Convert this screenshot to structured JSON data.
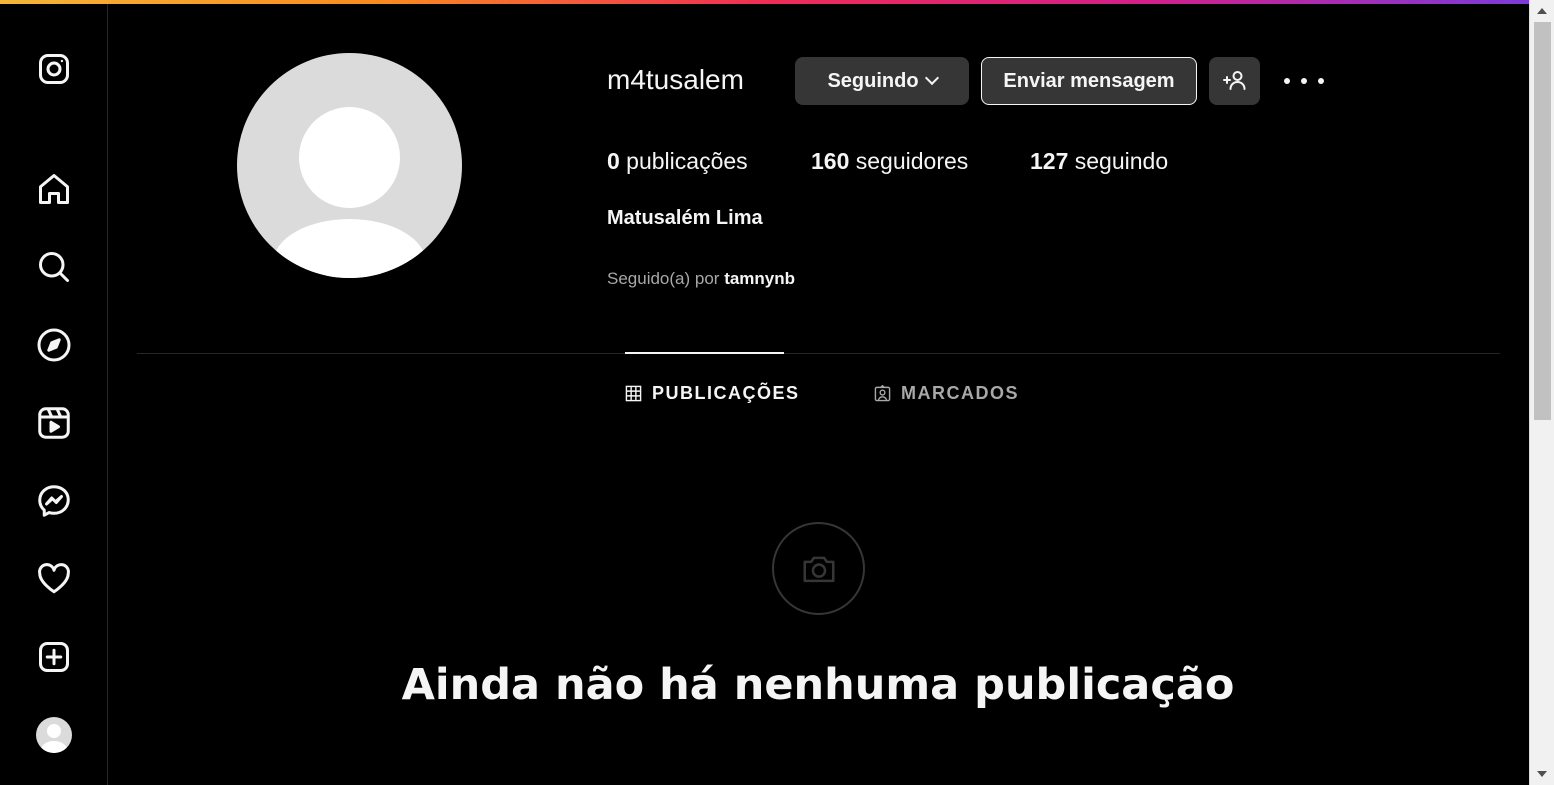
{
  "sidebar": {
    "items": [
      {
        "icon": "instagram-logo-icon"
      },
      {
        "icon": "home-icon"
      },
      {
        "icon": "search-icon"
      },
      {
        "icon": "explore-icon"
      },
      {
        "icon": "reels-icon"
      },
      {
        "icon": "messenger-icon"
      },
      {
        "icon": "heart-icon"
      },
      {
        "icon": "create-icon"
      },
      {
        "icon": "profile-avatar-icon"
      }
    ]
  },
  "profile": {
    "username": "m4tusalem",
    "following_button": "Seguindo",
    "message_button": "Enviar mensagem",
    "stats": {
      "posts_count": "0",
      "posts_label": " publicações",
      "followers_count": "160",
      "followers_label": " seguidores",
      "following_count": "127",
      "following_label": " seguindo"
    },
    "full_name": "Matusalém Lima",
    "followed_by_prefix": "Seguido(a) por ",
    "followed_by_user": "tamnynb"
  },
  "tabs": [
    {
      "label": "PUBLICAÇÕES",
      "active": true
    },
    {
      "label": "MARCADOS",
      "active": false
    }
  ],
  "empty_state": {
    "title": "Ainda não há nenhuma publicação"
  },
  "colors": {
    "background": "#000000",
    "button": "#363636",
    "text": "#f5f5f5",
    "secondary_text": "#a8a8a8"
  }
}
